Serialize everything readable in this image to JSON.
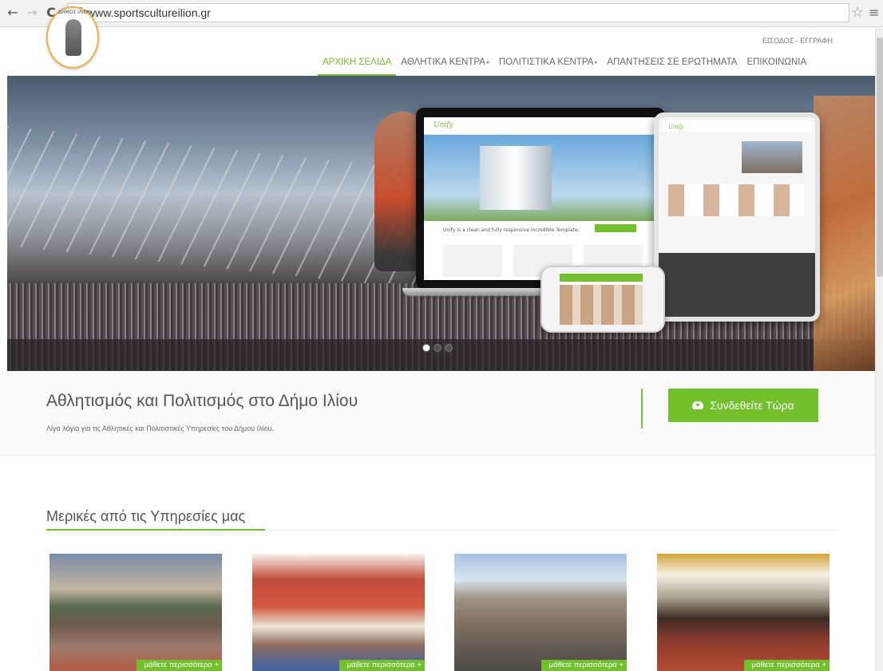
{
  "browser": {
    "url": "www.sportscultureilion.gr",
    "back_icon": "←",
    "forward_icon": "→",
    "reload_icon": "C",
    "star_icon": "☆",
    "menu_icon": "≡"
  },
  "header": {
    "logo_text": "ΔΗΜΟΣ ΙΛΙΟΥ",
    "login_link": "ΕΙΣΟΔΟΣ - ΕΓΓΡΑΦΗ",
    "nav": [
      {
        "label": "ΑΡΧΙΚΗ ΣΕΛΙΔΑ",
        "active": true
      },
      {
        "label": "ΑΘΛΗΤΙΚΑ ΚΕΝΤΡΑ",
        "dropdown": true
      },
      {
        "label": "ΠΟΛΙΤΙΣΤΙΚΑ ΚΕΝΤΡΑ",
        "dropdown": true
      },
      {
        "label": "ΑΠΑΝΤΗΣΕΙΣ ΣΕ ΕΡΩΤΗΜΑΤΑ"
      },
      {
        "label": "ΕΠΙΚΟΙΝΩΝΙΑ"
      }
    ]
  },
  "hero": {
    "mockup_logo": "Unify",
    "mockup_tagline": "Unify is a clean and fully responsive incredible Template.",
    "slides": 3,
    "active_slide": 1
  },
  "purchase": {
    "title": "Αθλητισμός και Πολιτισμός στο Δήμο Ιλίου",
    "subtitle": "Λίγα λόγια για τις Αθλητικές και Πολιτιστικές Υπηρεσίες του Δήμου Ιλίου.",
    "button": "Συνδεθείτε Τώρα"
  },
  "services": {
    "title": "Μερικές από τις Υπηρεσίες μας",
    "cards": [
      {
        "more": "μάθετε περισσότερα +"
      },
      {
        "more": "μάθετε περισσότερα +"
      },
      {
        "more": "μάθετε περισσότερα +"
      },
      {
        "more": "μάθετε περισσότερα +"
      }
    ]
  },
  "colors": {
    "accent": "#72c02c",
    "text": "#555555"
  }
}
